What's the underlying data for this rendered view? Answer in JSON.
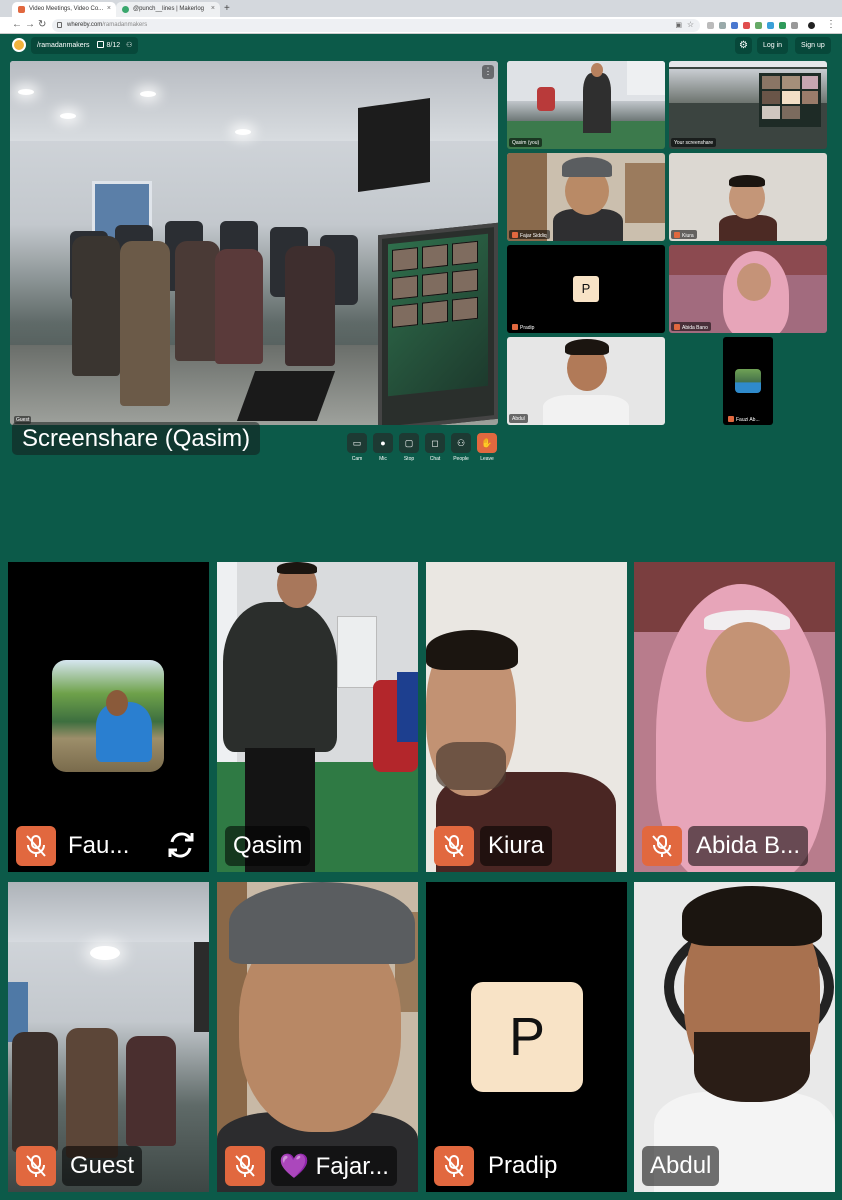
{
  "browser": {
    "tabs": [
      {
        "title": "Video Meetings, Video Co...",
        "active": true
      },
      {
        "title": "@punch__lines | Makerlog",
        "active": false
      }
    ],
    "url_host": "whereby.com",
    "url_path": "/ramadanmakers"
  },
  "header": {
    "room_name": "/ramadanmakers",
    "participant_count": "8/12",
    "login_label": "Log in",
    "signup_label": "Sign up"
  },
  "main_view": {
    "name": "Screenshare (Qasim)",
    "guest_tag": "Guest"
  },
  "controls": [
    {
      "label": "Cam",
      "icon": "camera-icon"
    },
    {
      "label": "Mic",
      "icon": "microphone-icon"
    },
    {
      "label": "Stop",
      "icon": "screenshare-icon"
    },
    {
      "label": "Chat",
      "icon": "chat-icon"
    },
    {
      "label": "People",
      "icon": "people-icon"
    },
    {
      "label": "Leave",
      "icon": "hand-wave-icon"
    }
  ],
  "side_tiles": [
    {
      "name": "Qasim (you)"
    },
    {
      "name": "Your screenshare"
    },
    {
      "name": "Fajar Siddiq"
    },
    {
      "name": "Kiura"
    },
    {
      "name": "Pradip",
      "avatar_letter": "P"
    },
    {
      "name": "Abida Bano"
    },
    {
      "name": "Abdul"
    },
    {
      "name": "Fauzi Ab..."
    }
  ],
  "grid_tiles": [
    {
      "name": "Fau...",
      "muted": true
    },
    {
      "name": "Qasim",
      "muted": false
    },
    {
      "name": "Kiura",
      "muted": true
    },
    {
      "name": "Abida B...",
      "muted": true
    },
    {
      "name": "Guest",
      "muted": true
    },
    {
      "name": "Fajar...",
      "muted": true,
      "heart": "💜"
    },
    {
      "name": "Pradip",
      "muted": true,
      "avatar_letter": "P"
    },
    {
      "name": "Abdul",
      "muted": false
    }
  ],
  "colors": {
    "background": "#0c5a49",
    "accent": "#e1683f",
    "avatar_bg": "#f8e3c6"
  }
}
